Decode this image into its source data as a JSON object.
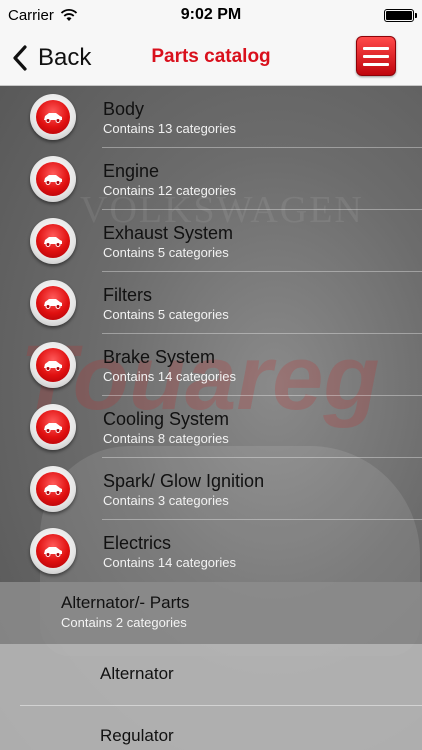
{
  "status_bar": {
    "carrier": "Carrier",
    "time": "9:02 PM"
  },
  "nav": {
    "back_label": "Back",
    "title": "Parts catalog"
  },
  "categories": [
    {
      "title": "Body",
      "subtitle": "Contains 13 categories"
    },
    {
      "title": "Engine",
      "subtitle": "Contains 12 categories"
    },
    {
      "title": "Exhaust System",
      "subtitle": "Contains 5 categories"
    },
    {
      "title": "Filters",
      "subtitle": "Contains 5 categories"
    },
    {
      "title": "Brake System",
      "subtitle": "Contains 14 categories"
    },
    {
      "title": "Cooling System",
      "subtitle": "Contains 8 categories"
    },
    {
      "title": "Spark/ Glow Ignition",
      "subtitle": "Contains 3 categories"
    },
    {
      "title": "Electrics",
      "subtitle": "Contains 14 categories"
    }
  ],
  "expanded": {
    "title": "Alternator/- Parts",
    "subtitle": "Contains 2 categories"
  },
  "subitems": [
    {
      "title": "Alternator"
    },
    {
      "title": "Regulator"
    }
  ],
  "watermark": {
    "brand": "VOLKSWAGEN",
    "model": "Touareg"
  },
  "colors": {
    "accent": "#d9101c",
    "menu_button": "#e01010",
    "background": "#6c6c6c"
  }
}
